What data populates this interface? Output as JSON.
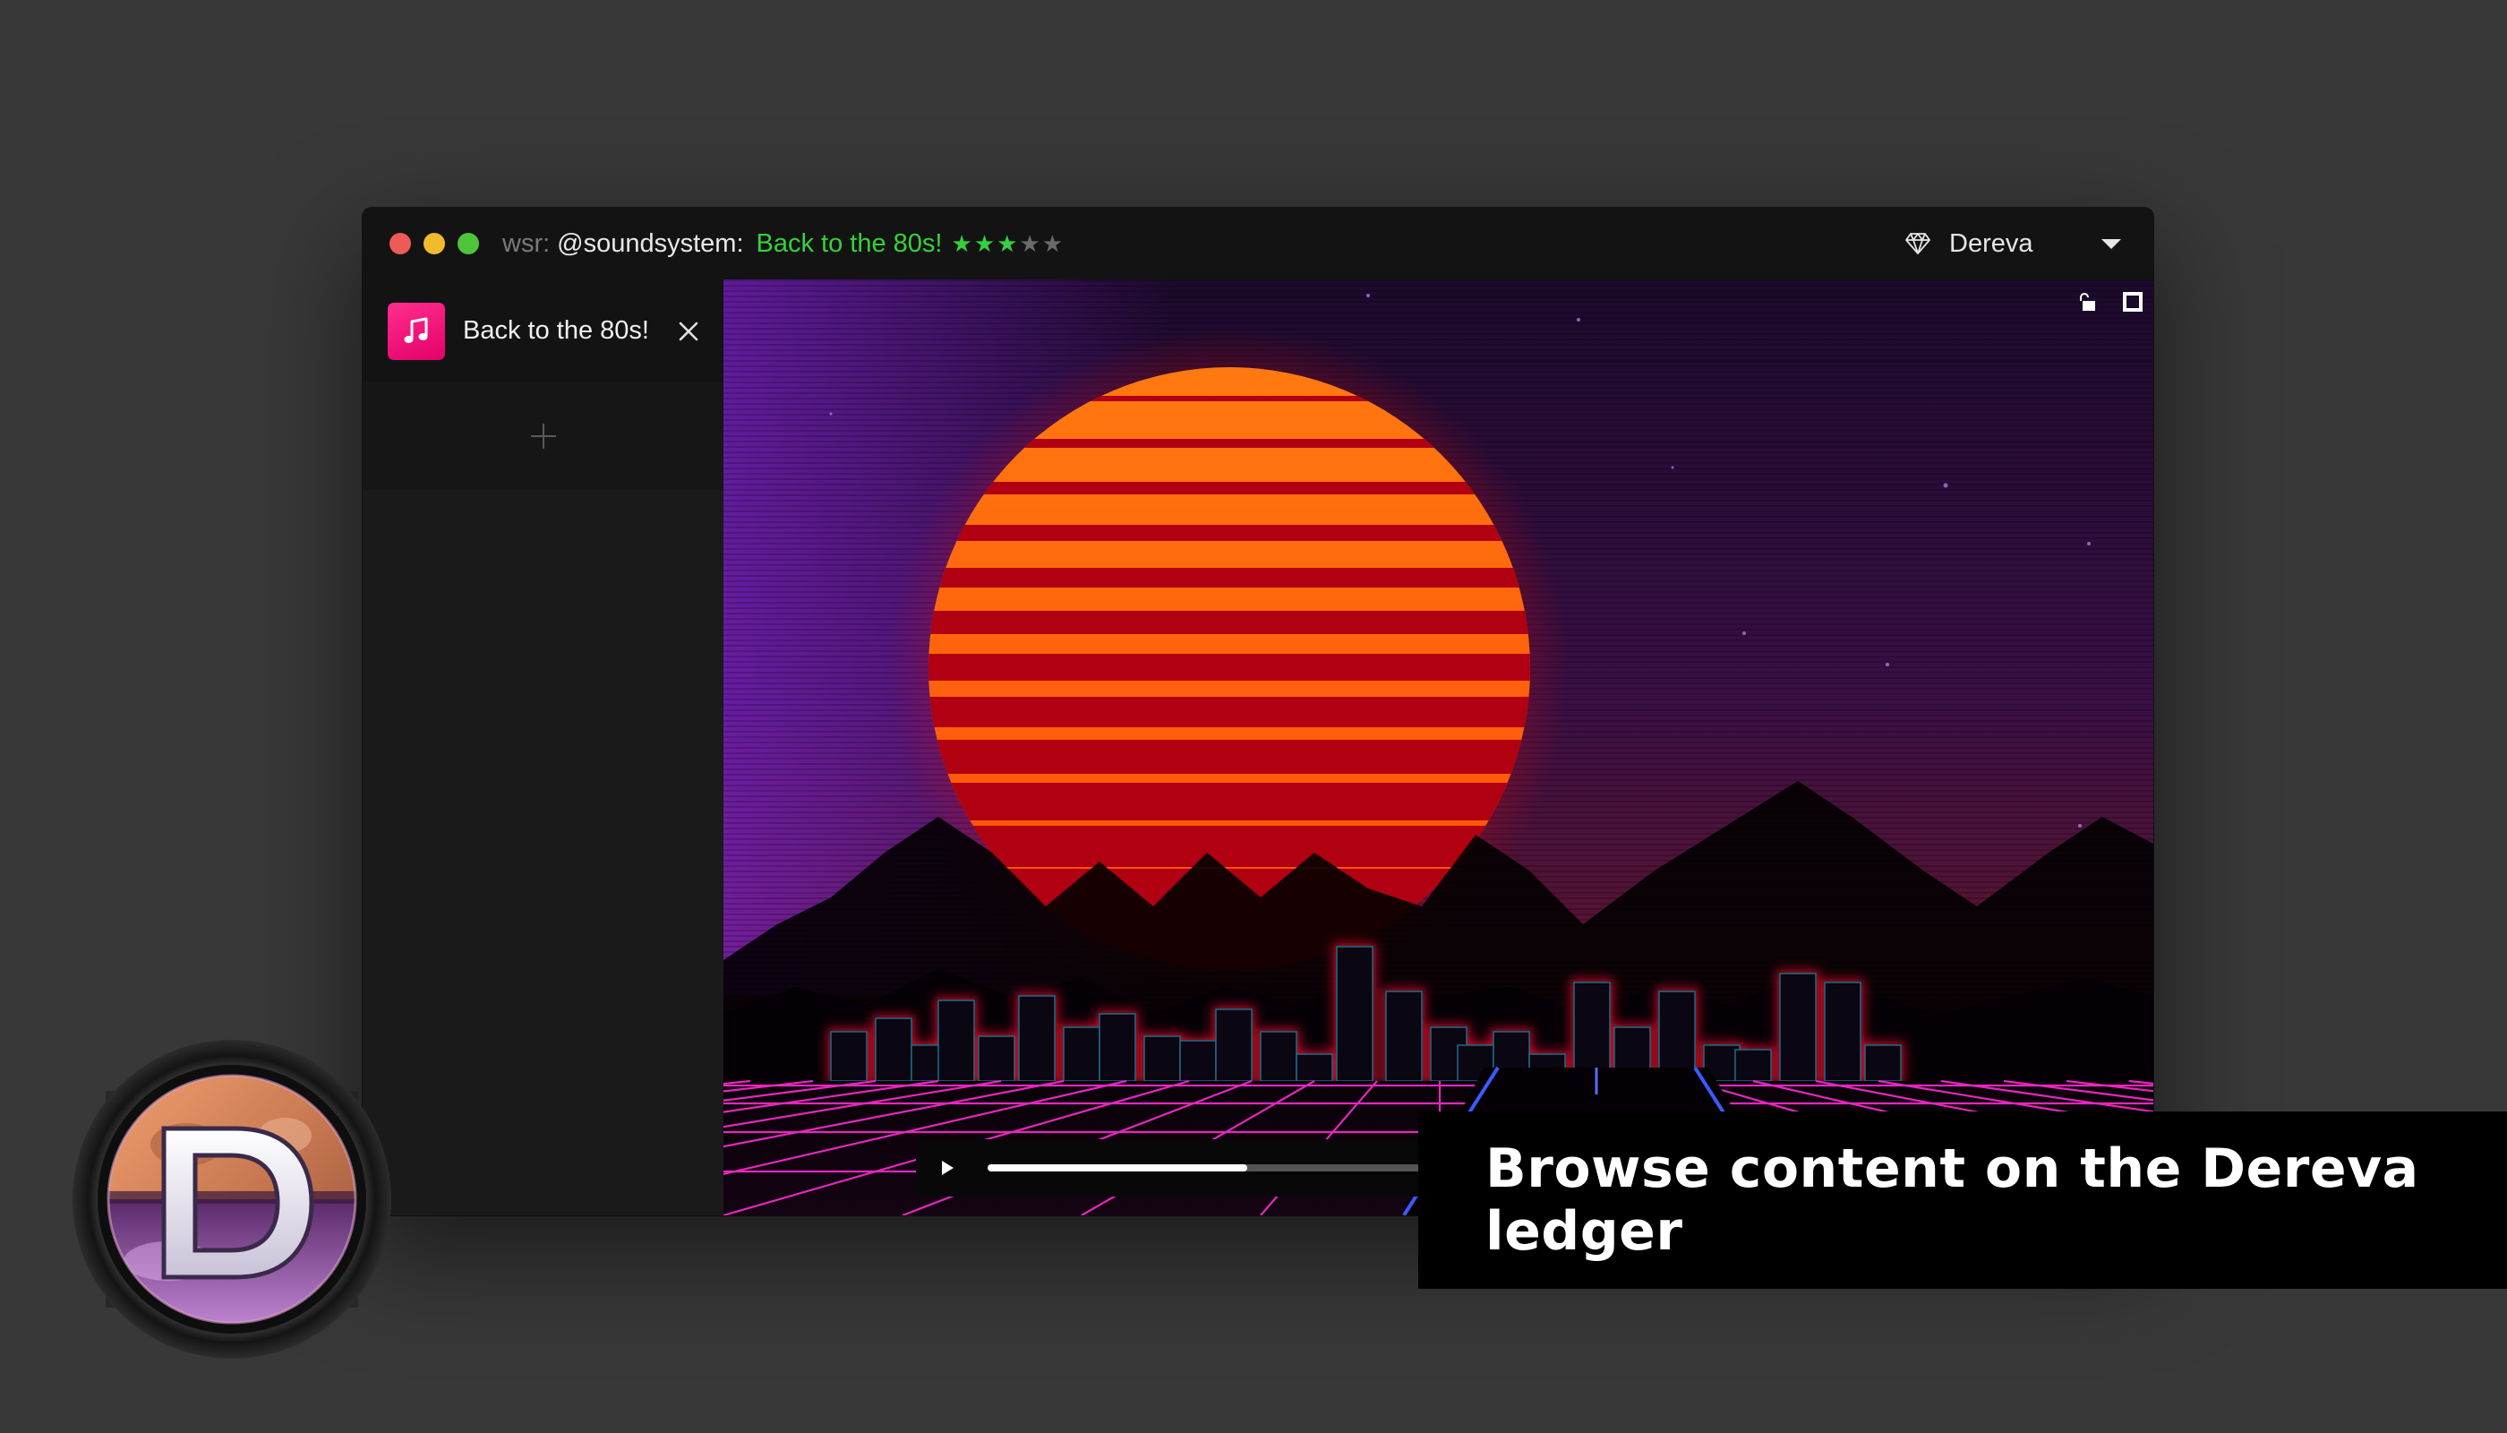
{
  "window": {
    "title": {
      "protocol": "wsr:",
      "user": "@soundsystem:",
      "name": "Back to the 80s!",
      "rating": 3,
      "rating_max": 5
    },
    "account": {
      "icon": "diamond-icon",
      "name": "Dereva"
    }
  },
  "sidebar": {
    "tabs": [
      {
        "icon": "music-note-icon",
        "label": "Back to the 80s!"
      }
    ],
    "add_icon": "plus-icon"
  },
  "player": {
    "progress": 0.58
  },
  "banner": {
    "text": "Browse content on the Dereva ledger"
  },
  "colors": {
    "accent_green": "#35d23a",
    "tab_icon_pink": "#ff1f86",
    "background": "#383838"
  }
}
